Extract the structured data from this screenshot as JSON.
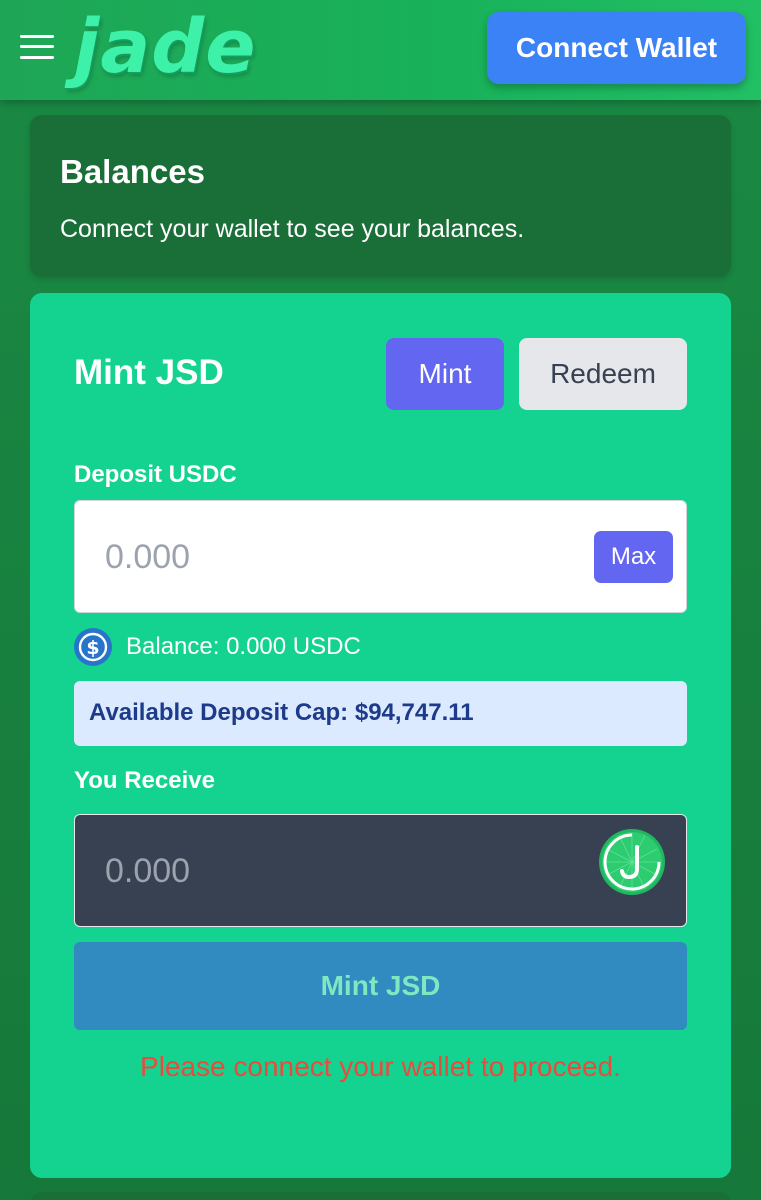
{
  "header": {
    "menu_icon": "hamburger-menu-icon",
    "logo_text": "jade",
    "connect_wallet_label": "Connect Wallet"
  },
  "balances": {
    "title": "Balances",
    "description": "Connect your wallet to see your balances."
  },
  "mint": {
    "title": "Mint JSD",
    "tabs": [
      {
        "label": "Mint",
        "active": true
      },
      {
        "label": "Redeem",
        "active": false
      }
    ],
    "deposit_label": "Deposit USDC",
    "deposit_placeholder": "0.000",
    "max_label": "Max",
    "balance_text": "Balance: 0.000 USDC",
    "deposit_cap_text": "Available Deposit Cap: $94,747.11",
    "receive_label": "You Receive",
    "receive_placeholder": "0.000",
    "mint_button_label": "Mint JSD",
    "error_message": "Please connect your wallet to proceed."
  },
  "icons": {
    "usdc": "usdc-coin-icon",
    "jsd": "jsd-coin-icon"
  },
  "colors": {
    "header_bg": "#1ea656",
    "logo": "#3df2a8",
    "connect_button": "#3b82f6",
    "balances_card": "#1a6f38",
    "mint_card": "#14d390",
    "tab_active": "#6366f1",
    "tab_inactive": "#e5e7eb",
    "cap_box": "#dbeafe",
    "cap_text": "#1e3a8a",
    "receive_box": "#374151",
    "mint_button": "#318ac0",
    "error": "#e74c3c"
  }
}
